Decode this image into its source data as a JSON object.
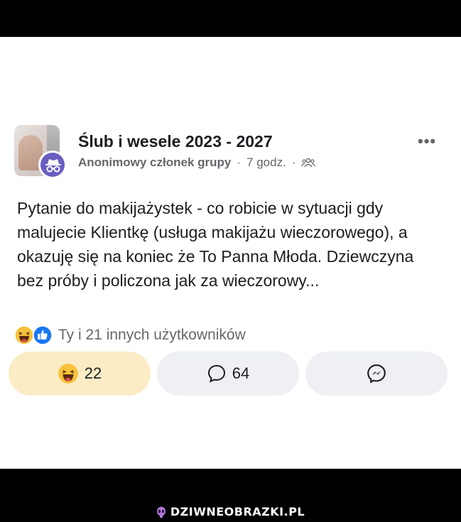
{
  "post": {
    "group_name": "Ślub i wesele 2023 - 2027",
    "author": "Anonimowy członek grupy",
    "separator": "·",
    "time": "7 godz.",
    "more_label": "•••",
    "body": "Pytanie do makijażystek - co robicie w sytuacji gdy malujecie Klientkę (usługa makijażu wieczorowego), a okazuję się na koniec że To Panna Młoda. Dziewczyna bez próby i policzona jak za wieczorowy..."
  },
  "reactions": {
    "summary": "Ty i 21 innych użytkowników",
    "icons": [
      "haha-icon",
      "like-icon"
    ]
  },
  "actions": {
    "reaction_count": "22",
    "comment_count": "64"
  },
  "colors": {
    "reaction_bg": "#fbecc6",
    "button_bg": "#eef0f3",
    "anon_badge": "#6a5fc1",
    "like_blue": "#1877f2"
  },
  "footer": {
    "logo_text": "DZIWNEOBRAZKI.PL"
  }
}
